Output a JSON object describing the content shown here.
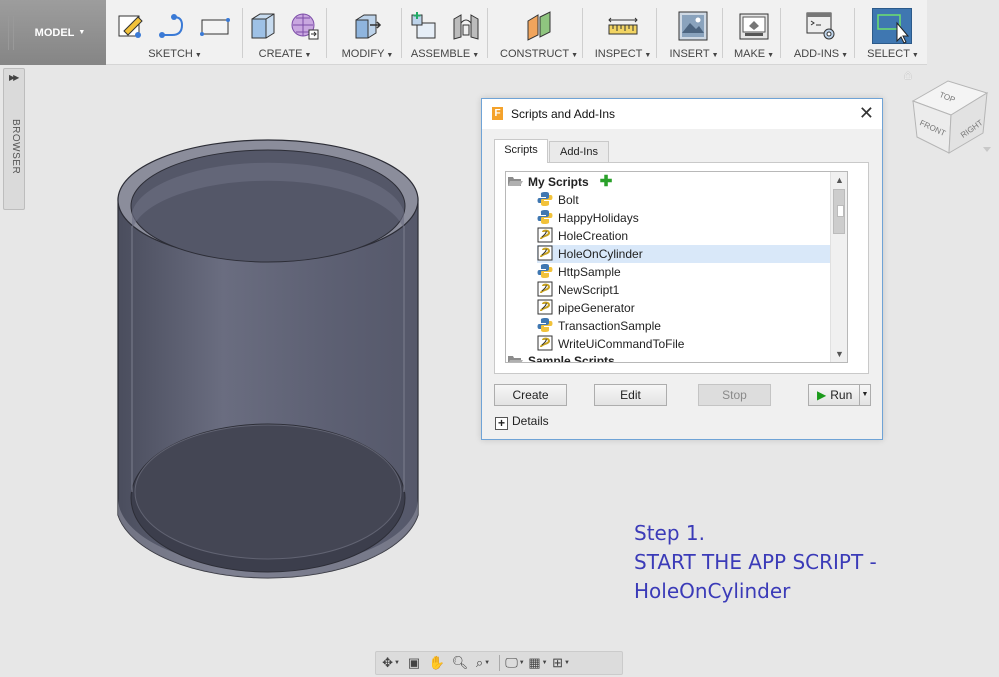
{
  "toolbar": {
    "model_label": "MODEL",
    "groups": [
      {
        "id": "sketch",
        "label": "SKETCH"
      },
      {
        "id": "create",
        "label": "CREATE"
      },
      {
        "id": "modify",
        "label": "MODIFY"
      },
      {
        "id": "assemble",
        "label": "ASSEMBLE"
      },
      {
        "id": "construct",
        "label": "CONSTRUCT"
      },
      {
        "id": "inspect",
        "label": "INSPECT"
      },
      {
        "id": "insert",
        "label": "INSERT"
      },
      {
        "id": "make",
        "label": "MAKE"
      },
      {
        "id": "addins",
        "label": "ADD-INS"
      },
      {
        "id": "select",
        "label": "SELECT"
      }
    ]
  },
  "browser": {
    "label": "BROWSER"
  },
  "viewcube": {
    "top": "TOP",
    "front": "FRONT",
    "right": "RIGHT"
  },
  "dialog": {
    "title": "Scripts and Add-Ins",
    "tabs": [
      "Scripts",
      "Add-Ins"
    ],
    "folders": [
      "My Scripts",
      "Sample Scripts"
    ],
    "scripts": [
      {
        "name": "Bolt",
        "icon": "python-icon"
      },
      {
        "name": "HappyHolidays",
        "icon": "python-icon"
      },
      {
        "name": "HoleCreation",
        "icon": "js-script-icon"
      },
      {
        "name": "HoleOnCylinder",
        "icon": "js-script-icon",
        "selected": true
      },
      {
        "name": "HttpSample",
        "icon": "python-icon"
      },
      {
        "name": "NewScript1",
        "icon": "js-script-icon"
      },
      {
        "name": "pipeGenerator",
        "icon": "js-script-icon"
      },
      {
        "name": "TransactionSample",
        "icon": "python-icon"
      },
      {
        "name": "WriteUiCommandToFile",
        "icon": "js-script-icon"
      }
    ],
    "buttons": {
      "create": "Create",
      "edit": "Edit",
      "stop": "Stop",
      "run": "Run"
    },
    "details_label": "Details"
  },
  "annotation": {
    "line1": "Step 1.",
    "line2": "START THE APP SCRIPT -",
    "line3": "HoleOnCylinder"
  },
  "colors": {
    "accent": "#3b3bb8",
    "selection": "#d9e8f9",
    "cylinder": "#5b5e72"
  }
}
